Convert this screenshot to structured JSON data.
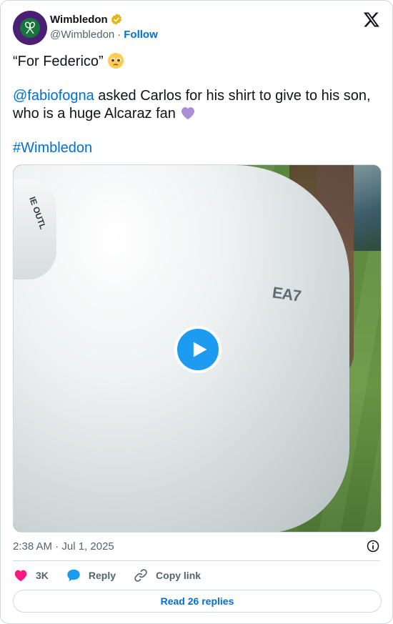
{
  "author": {
    "name": "Wimbledon",
    "handle": "@Wimbledon",
    "separator": "·",
    "follow_label": "Follow",
    "verified": true,
    "avatar_icon": "wimbledon-logo"
  },
  "tweet": {
    "line1": "“For Federico” ",
    "mention": "@fabiofogna",
    "body": " asked Carlos for his shirt to give to his son, who is a huge Alcaraz fan ",
    "hashtag": "#Wimbledon"
  },
  "media": {
    "type": "video",
    "sleeve_text": "IE OUTL",
    "brand_text": "EA7"
  },
  "timestamp": "2:38 AM · Jul 1, 2025",
  "actions": {
    "likes": "3K",
    "reply_label": "Reply",
    "copy_label": "Copy link"
  },
  "read_replies_label": "Read 26 replies",
  "colors": {
    "link": "#006fd6",
    "like": "#f91880",
    "reply": "#1d9bf0",
    "border": "#cfd9de",
    "muted": "#536471"
  }
}
